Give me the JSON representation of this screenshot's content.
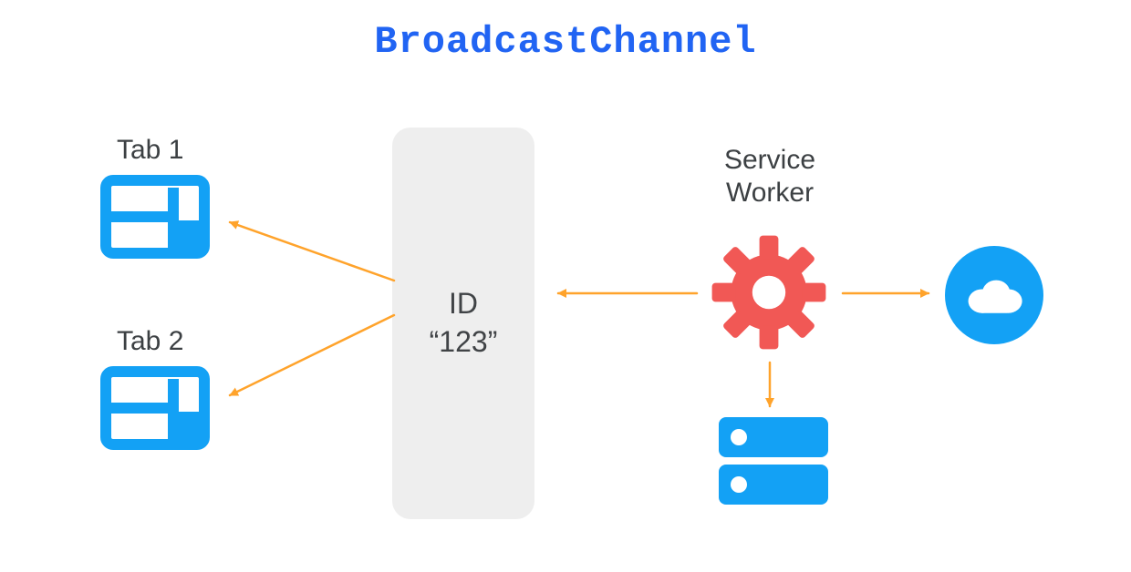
{
  "title": "BroadcastChannel",
  "tabs": [
    {
      "label": "Tab 1"
    },
    {
      "label": "Tab 2"
    }
  ],
  "channel": {
    "id_label": "ID",
    "id_value": "“123”"
  },
  "service_worker": {
    "label_line1": "Service",
    "label_line2": "Worker"
  },
  "icons": {
    "tab": "browser-tab-icon",
    "gear": "gear-icon",
    "cloud": "cloud-icon",
    "disk": "server-disk-icon"
  },
  "colors": {
    "title": "#2164f3",
    "accent": "#13a1f5",
    "gear": "#f15855",
    "arrow": "#ffa32b",
    "channel_bg": "#eeeeee",
    "text": "#3c4043"
  }
}
